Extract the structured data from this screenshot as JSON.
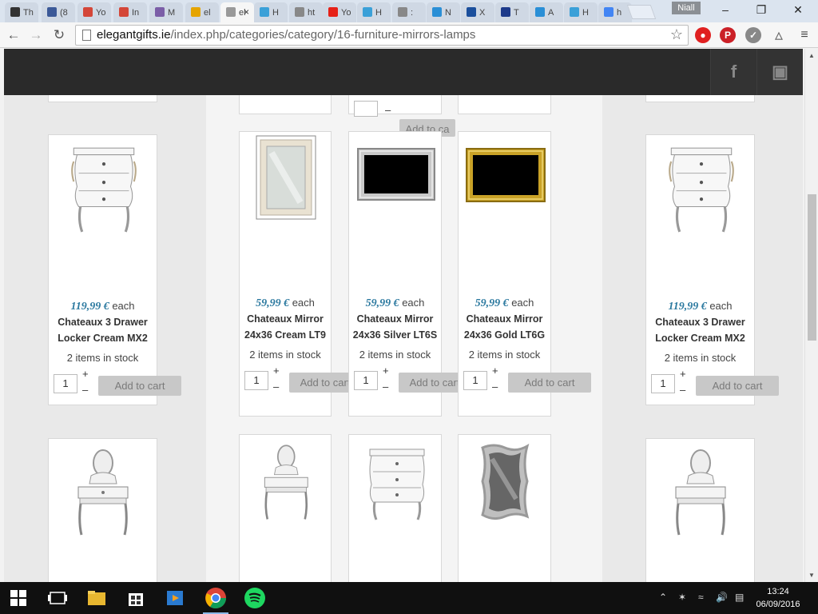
{
  "browser": {
    "tabs": [
      {
        "label": "Th",
        "color": "#333333"
      },
      {
        "label": "(8",
        "color": "#3b5998"
      },
      {
        "label": "Yo",
        "color": "#d44638"
      },
      {
        "label": "In",
        "color": "#d44638"
      },
      {
        "label": "M",
        "color": "#7b5ea7"
      },
      {
        "label": "el",
        "color": "#e5a400"
      },
      {
        "label": "el",
        "color": "#999999",
        "active": true
      },
      {
        "label": "H",
        "color": "#3aa0d8"
      },
      {
        "label": "ht",
        "color": "#888888"
      },
      {
        "label": "Yo",
        "color": "#e62117"
      },
      {
        "label": "H",
        "color": "#3aa0d8"
      },
      {
        "label": ":",
        "color": "#888888"
      },
      {
        "label": "N",
        "color": "#2a8fd6"
      },
      {
        "label": "X",
        "color": "#1b4f9c"
      },
      {
        "label": "T",
        "color": "#1d3a8a"
      },
      {
        "label": "A",
        "color": "#2a8fd6"
      },
      {
        "label": "H",
        "color": "#3aa0d8"
      },
      {
        "label": "h",
        "color": "#4285f4"
      }
    ],
    "user_name": "Niall",
    "url_host": "elegantgifts.ie",
    "url_path": "/index.php/categories/category/16-furniture-mirrors-lamps"
  },
  "header": {
    "social": [
      "f",
      "instagram"
    ]
  },
  "products_row": [
    {
      "price": "119,99 €",
      "unit": "each",
      "name_line1": "Chateaux 3 Drawer",
      "name_line2": "Locker Cream MX2",
      "stock": "2 items in stock",
      "qty": "1",
      "add_label": "Add to cart",
      "image": "locker"
    },
    {
      "price": "59,99 €",
      "unit": "each",
      "name_line1": "Chateaux Mirror",
      "name_line2": "24x36 Cream LT9",
      "stock": "2 items in stock",
      "qty": "1",
      "add_label": "Add to cart",
      "image": "cream-mirror"
    },
    {
      "price": "59,99 €",
      "unit": "each",
      "name_line1": "Chateaux Mirror",
      "name_line2": "24x36 Silver LT6S",
      "stock": "2 items in stock",
      "qty": "1",
      "add_label": "Add to cart",
      "image": "silver-mirror"
    },
    {
      "price": "59,99 €",
      "unit": "each",
      "name_line1": "Chateaux Mirror",
      "name_line2": "24x36 Gold LT6G",
      "stock": "2 items in stock",
      "qty": "1",
      "add_label": "Add to cart",
      "image": "gold-mirror"
    },
    {
      "price": "119,99 €",
      "unit": "each",
      "name_line1": "Chateaux 3 Drawer",
      "name_line2": "Locker Cream MX2",
      "stock": "2 items in stock",
      "qty": "1",
      "add_label": "Add to cart",
      "image": "locker"
    }
  ],
  "top_partial": {
    "add_label": "Add to ca"
  },
  "qty_controls": {
    "plus": "+",
    "minus": "–"
  },
  "taskbar": {
    "time": "13:24",
    "date": "06/09/2016"
  }
}
